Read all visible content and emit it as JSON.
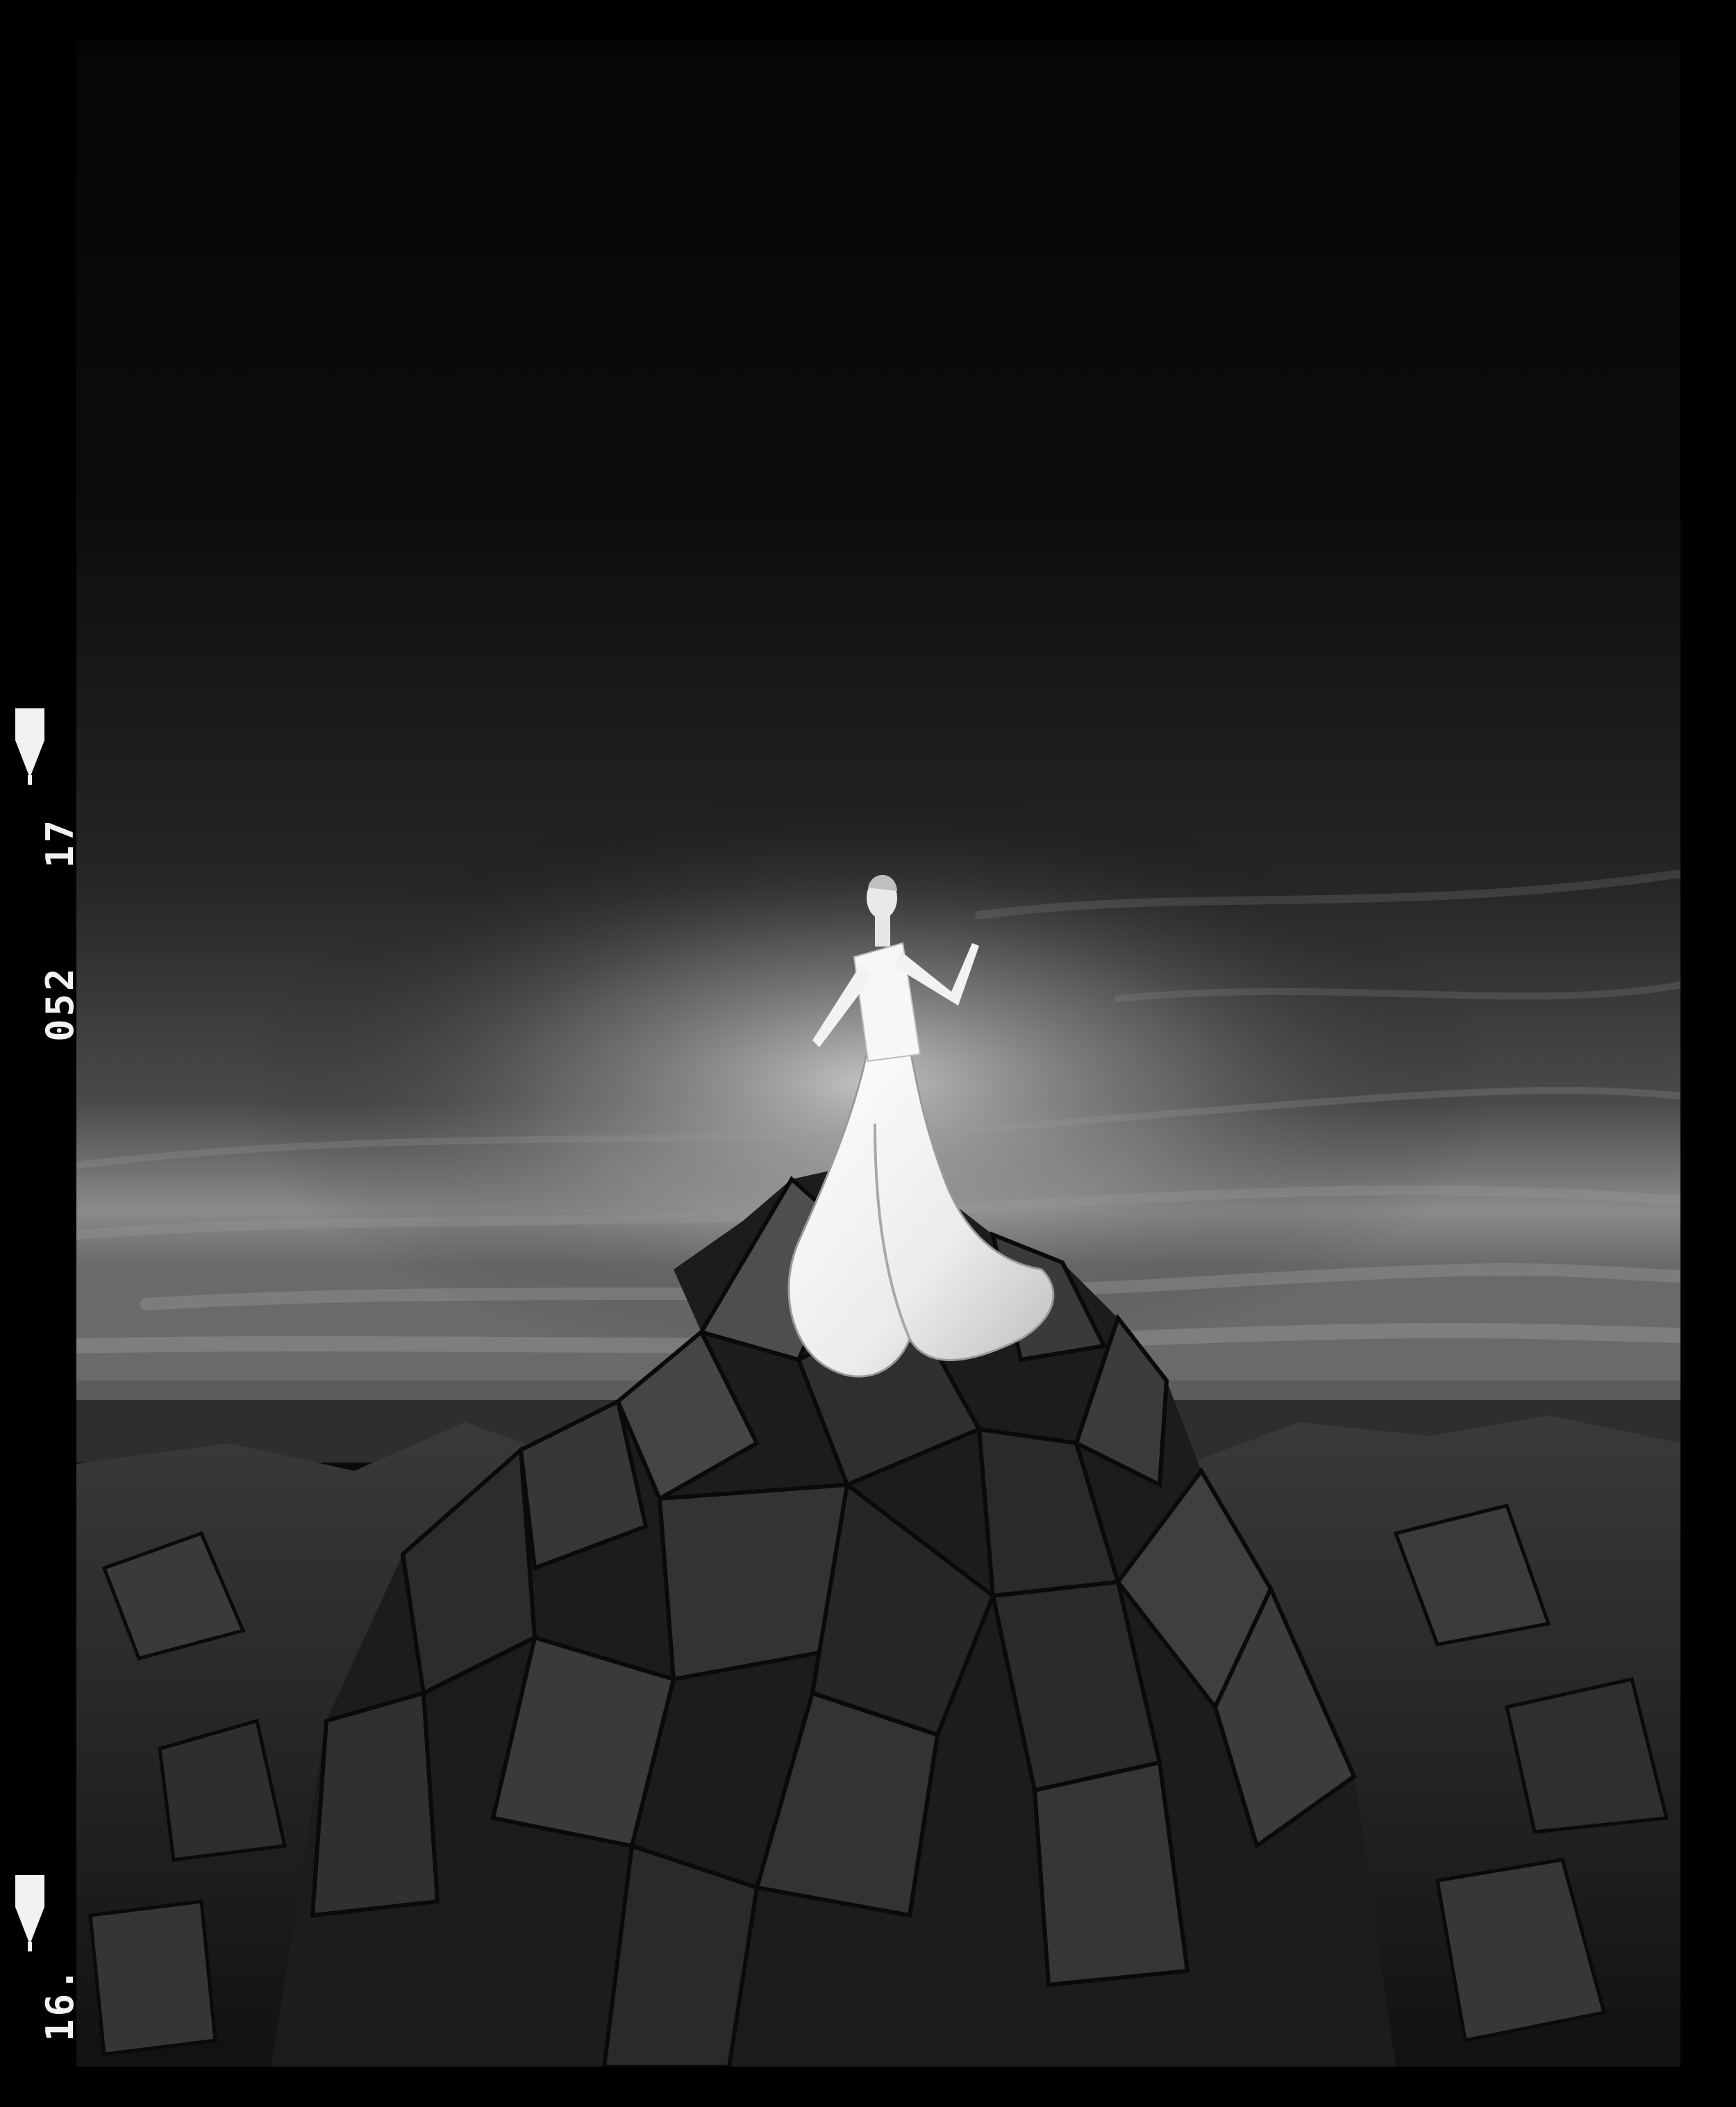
{
  "film_edge": {
    "frame_number_upper": "17",
    "frame_number_lower": "16.",
    "stock_code": "052"
  },
  "scene": {
    "sky_color": "#1a1a1a",
    "horizon_color": "#b8b8b8",
    "rock_color": "#2b2b2b",
    "dress_color": "#f4f4f4"
  }
}
